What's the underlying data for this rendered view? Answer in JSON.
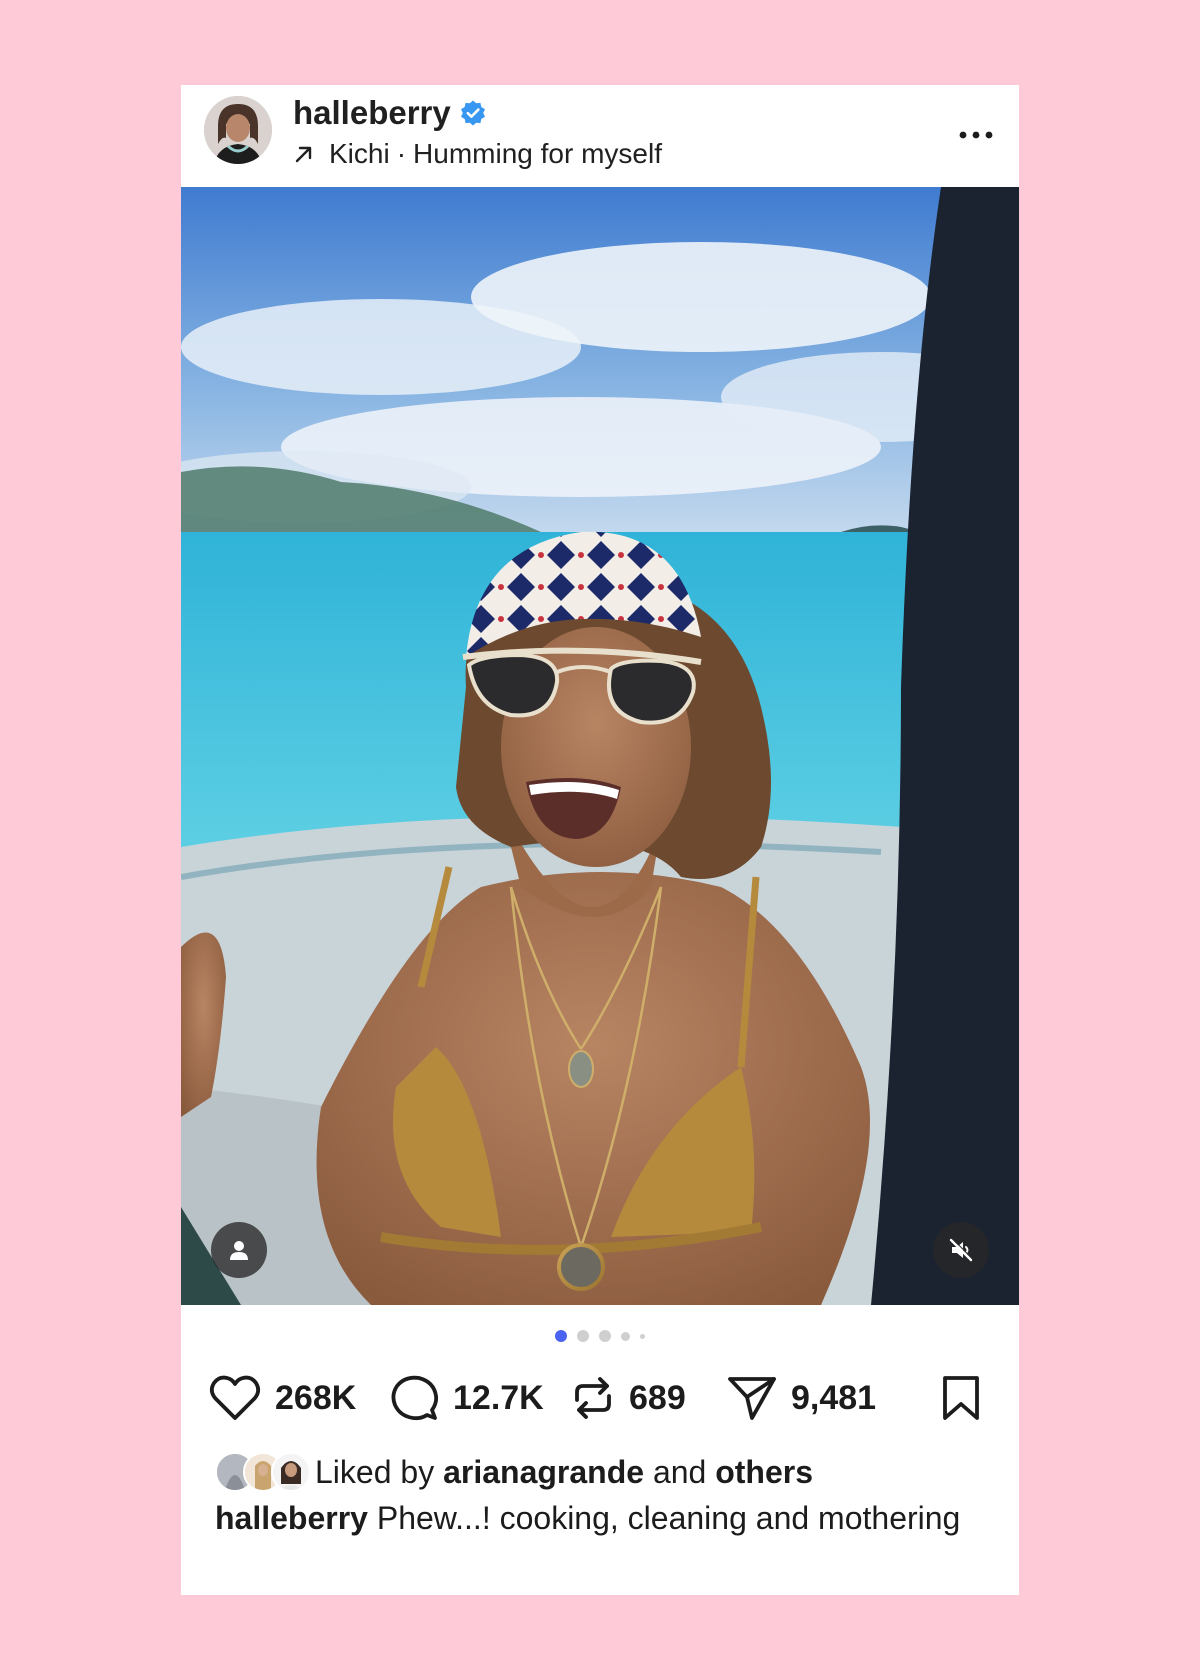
{
  "post": {
    "username": "halleberry",
    "verified": true,
    "audio_artist": "Kichi",
    "audio_separator": "·",
    "audio_title": "Humming for myself",
    "carousel": {
      "count": 5,
      "active_index": 0
    },
    "stats": {
      "likes": "268K",
      "comments": "12.7K",
      "reposts": "689",
      "shares": "9,481"
    },
    "liked_by": {
      "prefix": "Liked by",
      "user": "arianagrande",
      "connector": "and",
      "others": "others"
    },
    "caption": {
      "username": "halleberry",
      "text": "Phew...! cooking, cleaning and mothering"
    }
  },
  "icons": {
    "verified": "verified-badge-icon",
    "audio": "arrow-up-right-icon",
    "more": "more-horizontal-icon",
    "like": "heart-icon",
    "comment": "comment-bubble-icon",
    "repost": "repost-icon",
    "share": "paper-plane-icon",
    "save": "bookmark-icon",
    "tag": "user-icon",
    "mute": "speaker-muted-icon"
  },
  "colors": {
    "background": "#ffcad7",
    "verified": "#3897f0",
    "active_dot": "#4a63f0"
  }
}
